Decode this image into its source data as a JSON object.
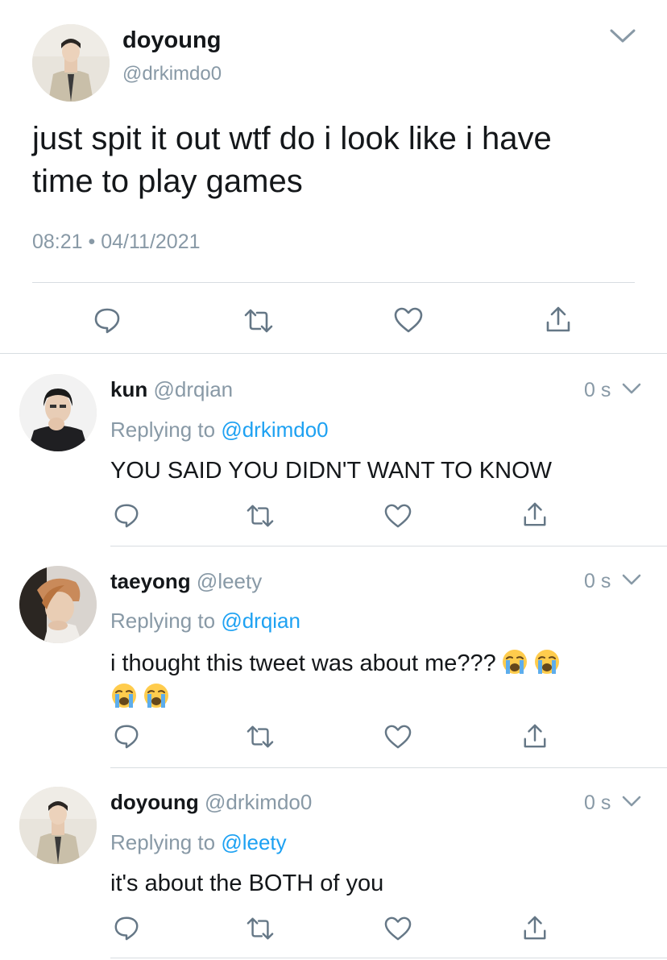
{
  "main_tweet": {
    "display_name": "doyoung",
    "handle": "@drkimdo0",
    "text": "just spit it out wtf do i look like i have time to play games",
    "time": "08:21",
    "separator": "•",
    "date": "04/11/2021"
  },
  "replies": [
    {
      "display_name": "kun",
      "handle": "@drqian",
      "time_ago": "0 s",
      "replying_prefix": "Replying to",
      "replying_handle": "@drkimdo0",
      "text": "YOU SAID YOU DIDN'T WANT TO KNOW"
    },
    {
      "display_name": "taeyong",
      "handle": "@leety",
      "time_ago": "0 s",
      "replying_prefix": "Replying to",
      "replying_handle": "@drqian",
      "text": "i thought this tweet was about me???",
      "emoji_count": 4,
      "emoji_name": "loudly-crying-face"
    },
    {
      "display_name": "doyoung",
      "handle": "@drkimdo0",
      "time_ago": "0 s",
      "replying_prefix": "Replying to",
      "replying_handle": "@leety",
      "text": "it's about the BOTH of you"
    }
  ],
  "icons": {
    "reply": "reply-icon",
    "retweet": "retweet-icon",
    "like": "heart-icon",
    "share": "share-icon",
    "menu": "chevron-down-icon"
  },
  "colors": {
    "link": "#1da1f2",
    "muted": "#8899a6",
    "text": "#14171a",
    "divider": "#d8dde1"
  }
}
